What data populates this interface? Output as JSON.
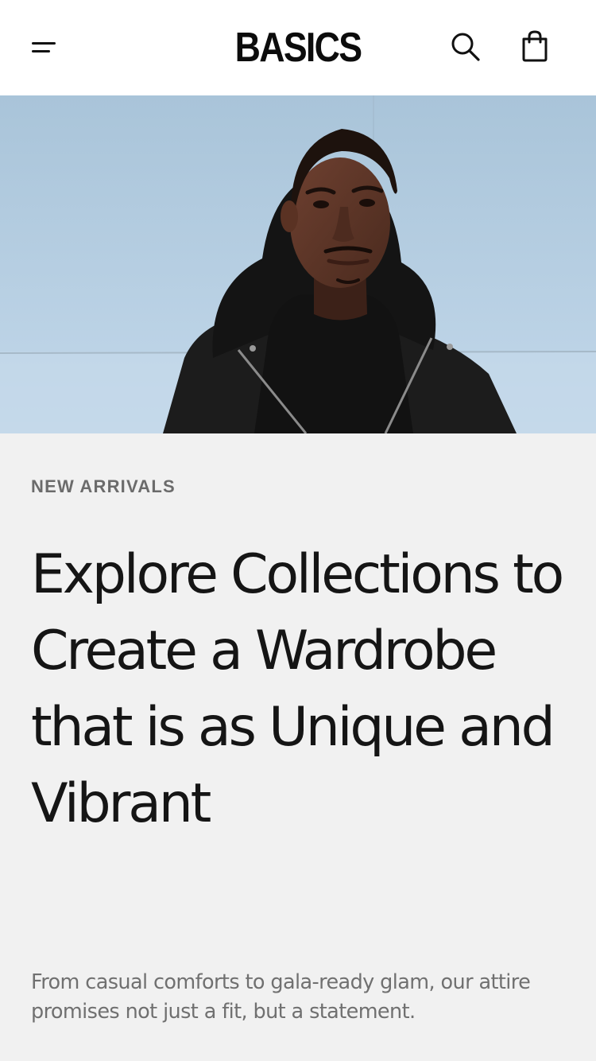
{
  "header": {
    "brand": "BASICS",
    "menu_icon": "menu-icon",
    "search_icon": "search-icon",
    "cart_icon": "shopping-bag-icon"
  },
  "hero": {
    "image_subject": "man-in-black-hoodie-photo"
  },
  "content": {
    "eyebrow": "NEW ARRIVALS",
    "headline": "Explore Collections to Create a Wardrobe that is as Unique and Vibrant",
    "subtext": "From casual comforts to gala-ready glam, our attire promises not just a fit, but a statement."
  },
  "colors": {
    "header_bg": "#ffffff",
    "page_bg": "#f1f1f1",
    "text_primary": "#151515",
    "text_muted": "#6b6b6b"
  }
}
